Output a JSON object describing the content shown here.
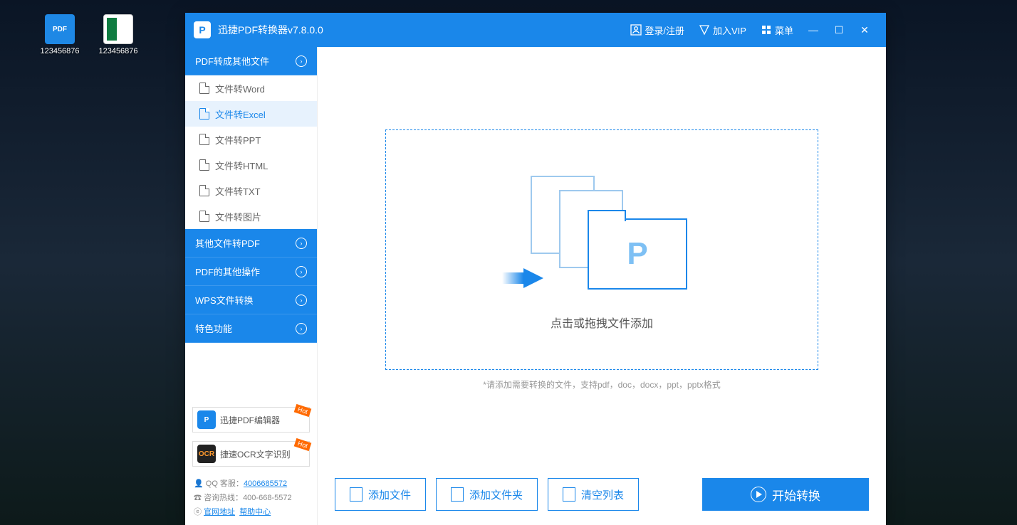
{
  "desktop": {
    "icons": [
      {
        "label": "123456876",
        "type": "pdf"
      },
      {
        "label": "123456876",
        "type": "excel"
      }
    ]
  },
  "titlebar": {
    "app_title": "迅捷PDF转换器v7.8.0.0",
    "login": "登录/注册",
    "vip": "加入VIP",
    "menu": "菜单"
  },
  "sidebar": {
    "cat1": "PDF转成其他文件",
    "items": [
      "文件转Word",
      "文件转Excel",
      "文件转PPT",
      "文件转HTML",
      "文件转TXT",
      "文件转图片"
    ],
    "cat2": "其他文件转PDF",
    "cat3": "PDF的其他操作",
    "cat4": "WPS文件转换",
    "cat5": "特色功能",
    "promo1": "迅捷PDF编辑器",
    "promo2": "捷速OCR文字识别",
    "qq_label": "QQ 客服：",
    "qq_value": "4006685572",
    "hotline_label": "咨询热线：",
    "hotline_value": "400-668-5572",
    "site_label": "官网地址",
    "help_label": "帮助中心",
    "hot": "Hot"
  },
  "main": {
    "drop_text": "点击或拖拽文件添加",
    "drop_hint": "*请添加需要转换的文件，支持pdf，doc，docx，ppt，pptx格式",
    "add_file": "添加文件",
    "add_folder": "添加文件夹",
    "clear_list": "清空列表",
    "start": "开始转换"
  }
}
